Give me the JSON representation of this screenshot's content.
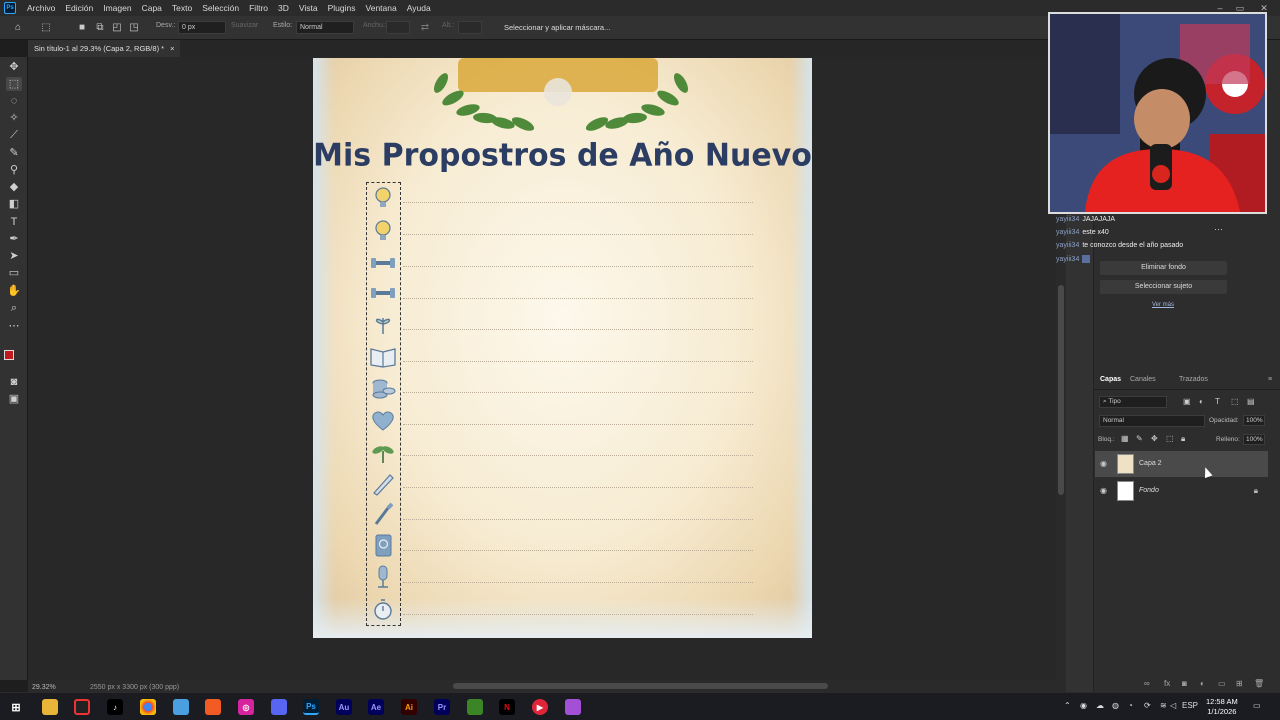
{
  "menu": [
    "Archivo",
    "Edición",
    "Imagen",
    "Capa",
    "Texto",
    "Selección",
    "Filtro",
    "3D",
    "Vista",
    "Plugins",
    "Ventana",
    "Ayuda"
  ],
  "options": {
    "desv_label": "Desv.:",
    "desv_value": "0 px",
    "suavizar": "Suavizar",
    "estilo_label": "Estilo:",
    "estilo_value": "Normal",
    "anchura": "Anchu.:",
    "alt": "Alt.:",
    "select_mask": "Seleccionar y aplicar máscara..."
  },
  "document": {
    "tab_title": "Sin título-1 al 29.3% (Capa 2, RGB/8) *",
    "tab_close": "×",
    "title": "Mis Propostros de Año Nuevo",
    "icons": [
      "lightbulb-icon",
      "lightbulb-icon",
      "dumbbell-icon",
      "dumbbell-icon",
      "sprout-icon",
      "book-icon",
      "coins-icon",
      "heart-icon",
      "plant-icon",
      "pen-icon",
      "brush-icon",
      "passport-icon",
      "microphone-icon",
      "stopwatch-icon"
    ]
  },
  "status": {
    "zoom": "29.32%",
    "dimensions": "2550 px x 3300 px (300 ppp)"
  },
  "chat": [
    {
      "user": "yayiii34",
      "text": "JAJAJAJA"
    },
    {
      "user": "yayiii34",
      "text": "este x40"
    },
    {
      "user": "yayiii34",
      "text": "te conozco desde el año pasado"
    },
    {
      "user": "yayiii34",
      "text": ""
    }
  ],
  "properties": {
    "buttons": [
      "Eliminar fondo",
      "Seleccionar sujeto"
    ],
    "more": "Ver más"
  },
  "layers_panel": {
    "tabs": [
      "Capas",
      "Canales",
      "Trazados"
    ],
    "filter": "Tipo",
    "blend": "Normal",
    "opacity_label": "Opacidad:",
    "opacity_value": "100%",
    "lock_label": "Bloq.:",
    "fill_label": "Relleno:",
    "fill_value": "100%",
    "layers": [
      {
        "name": "Capa 2"
      },
      {
        "name": "Fondo"
      }
    ]
  },
  "taskbar": {
    "apps": [
      "Au",
      "Ae",
      "Ai",
      "Pr"
    ],
    "lang": "ESP",
    "time": "12:58 AM",
    "date": "1/1/2026"
  },
  "colors": {
    "accent": "#31a8ff",
    "title_blue": "#2c3d63",
    "foreground_color": "#c0191e"
  }
}
